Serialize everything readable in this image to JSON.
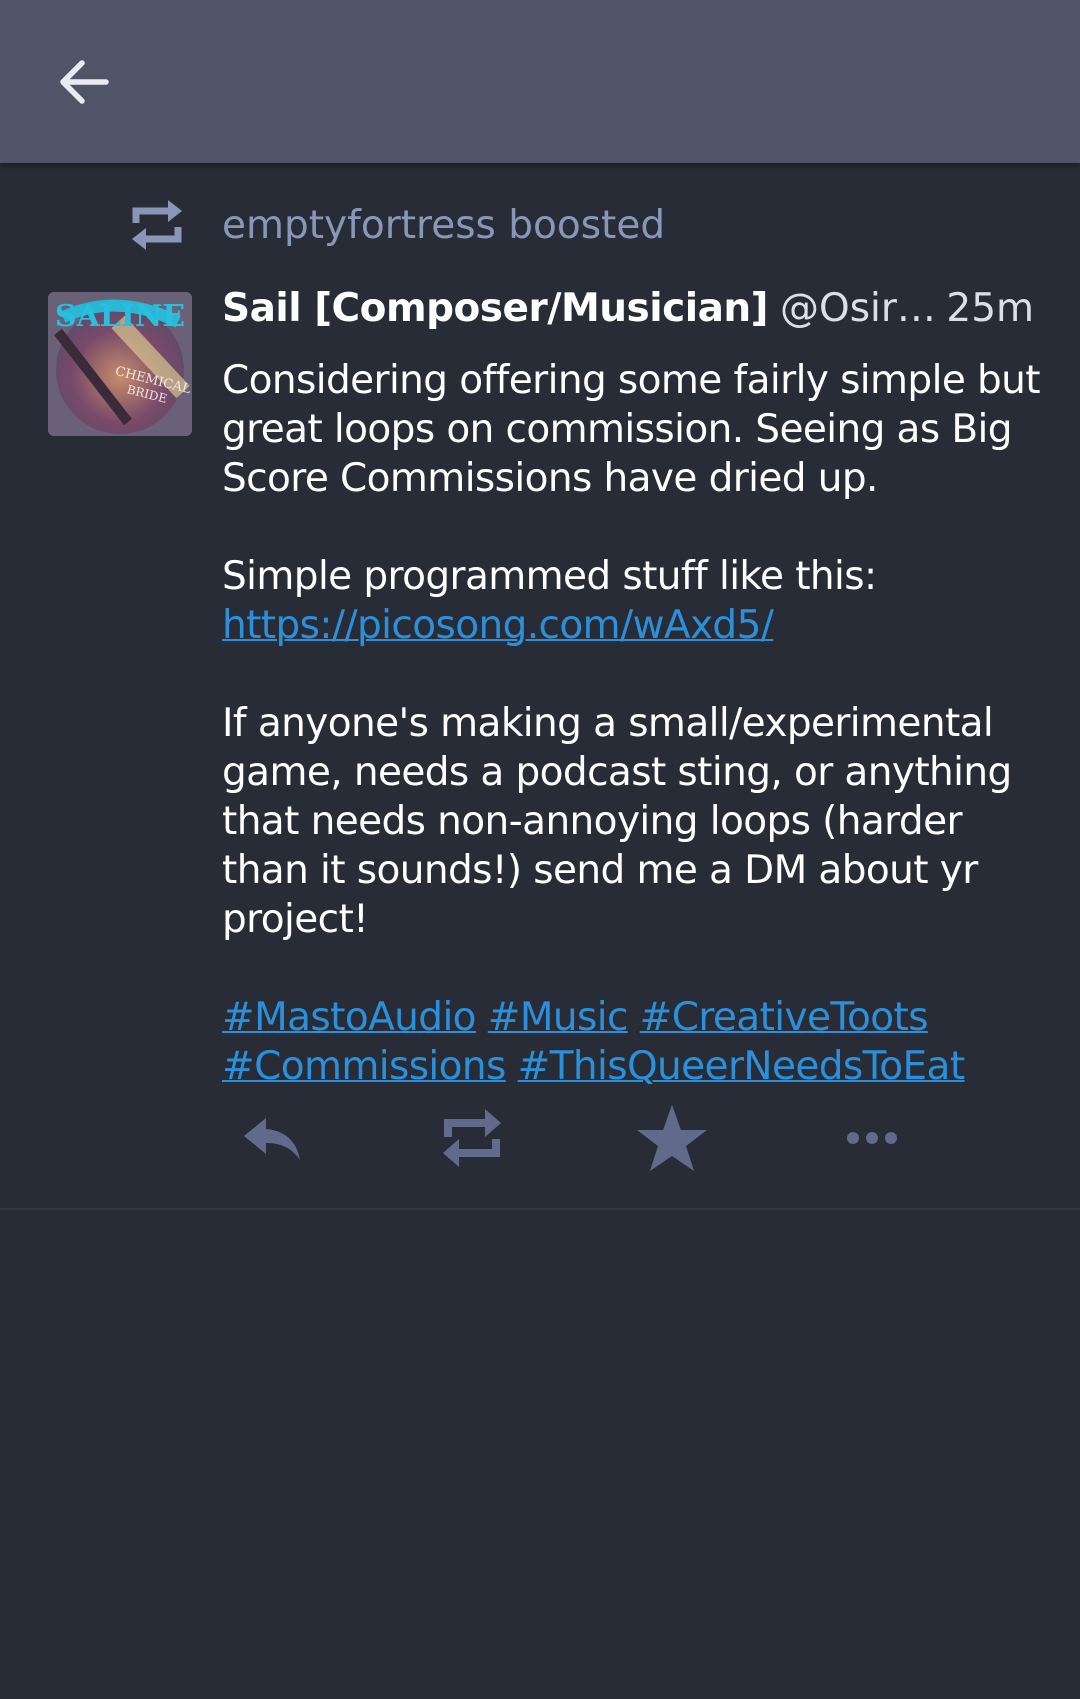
{
  "topbar": {
    "back_icon": "arrow-left-icon"
  },
  "status": {
    "boost_icon": "retweet-icon",
    "boosted_by": "emptyfortress boosted",
    "author": {
      "display_name": "Sail [Composer/Musician]",
      "handle": "@OsirisSa…",
      "avatar_icon": "avatar-image"
    },
    "time": "25m",
    "content": {
      "para1": "Considering offering some fairly simple but great loops on commission. Seeing as Big Score Commissions have dried up.",
      "para2_text": "Simple programmed stuff like this: ",
      "para2_link": "https://picosong.com/wAxd5/",
      "para3": "If anyone's making a small/experimental game, needs a podcast sting, or anything that needs non-annoying loops (harder than it sounds!) send me a DM about yr project!",
      "hashtags": [
        "#MastoAudio",
        "#Music",
        "#CreativeToots",
        "#Commissions",
        "#ThisQueerNeedsToEat"
      ]
    },
    "actions": {
      "reply_icon": "reply-icon",
      "boost_icon": "retweet-icon",
      "favourite_icon": "star-icon",
      "more_icon": "ellipsis-icon"
    }
  },
  "colors": {
    "background": "#282c37",
    "topbar": "#4f5467",
    "link": "#2b90d9",
    "muted": "#8a96b8",
    "action_icon": "#616a8a"
  }
}
